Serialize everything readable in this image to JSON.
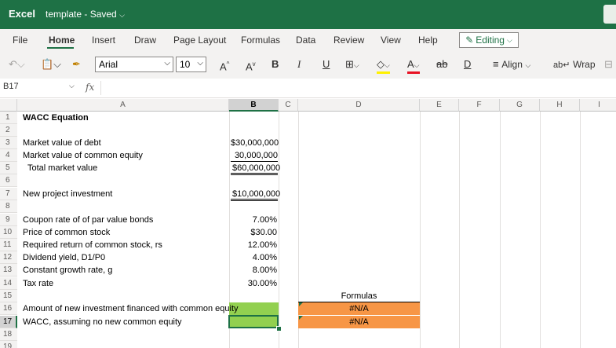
{
  "app": {
    "name": "Excel",
    "document": "template - Saved"
  },
  "menu": [
    "File",
    "Home",
    "Insert",
    "Draw",
    "Page Layout",
    "Formulas",
    "Data",
    "Review",
    "View",
    "Help"
  ],
  "editing_label": "Editing",
  "toolbar": {
    "font": "Arial",
    "size": "10",
    "bold": "B",
    "italic": "I",
    "underline": "U",
    "strike": "ab",
    "grow": "A",
    "shrink": "A",
    "align": "Align",
    "wrap": "Wrap",
    "fontcolor": "A"
  },
  "formula_bar": {
    "name_box": "B17",
    "fx": "fx",
    "content": ""
  },
  "columns": [
    "A",
    "B",
    "C",
    "D",
    "E",
    "F",
    "G",
    "H",
    "I"
  ],
  "rows": [
    "1",
    "2",
    "3",
    "4",
    "5",
    "6",
    "7",
    "8",
    "9",
    "10",
    "11",
    "12",
    "13",
    "14",
    "15",
    "16",
    "17",
    "18",
    "19"
  ],
  "cells": {
    "a1": "WACC Equation",
    "a3": "Market value of debt",
    "b3": "$30,000,000",
    "a4": "Market value of common equity",
    "b4": "30,000,000",
    "a5": "Total market value",
    "b5": "$60,000,000",
    "a7": "New project investment",
    "b7": "$10,000,000",
    "a9": "Coupon rate of of par value bonds",
    "b9": "7.00%",
    "a10": "Price of common stock",
    "b10": "$30.00",
    "a11": "Required return of common stock, rs",
    "b11": "12.00%",
    "a12": "Dividend yield, D1/P0",
    "b12": "4.00%",
    "a13": "Constant growth rate, g",
    "b13": "8.00%",
    "a14": "Tax rate",
    "b14": "30.00%",
    "d15": "Formulas",
    "a16": "Amount of new investment financed with common equity",
    "d16": "#N/A",
    "a17": "WACC, assuming no new common equity",
    "d17": "#N/A"
  },
  "colors": {
    "brand": "#1e7145",
    "green_fill": "#92d050",
    "orange_fill": "#f79646"
  }
}
